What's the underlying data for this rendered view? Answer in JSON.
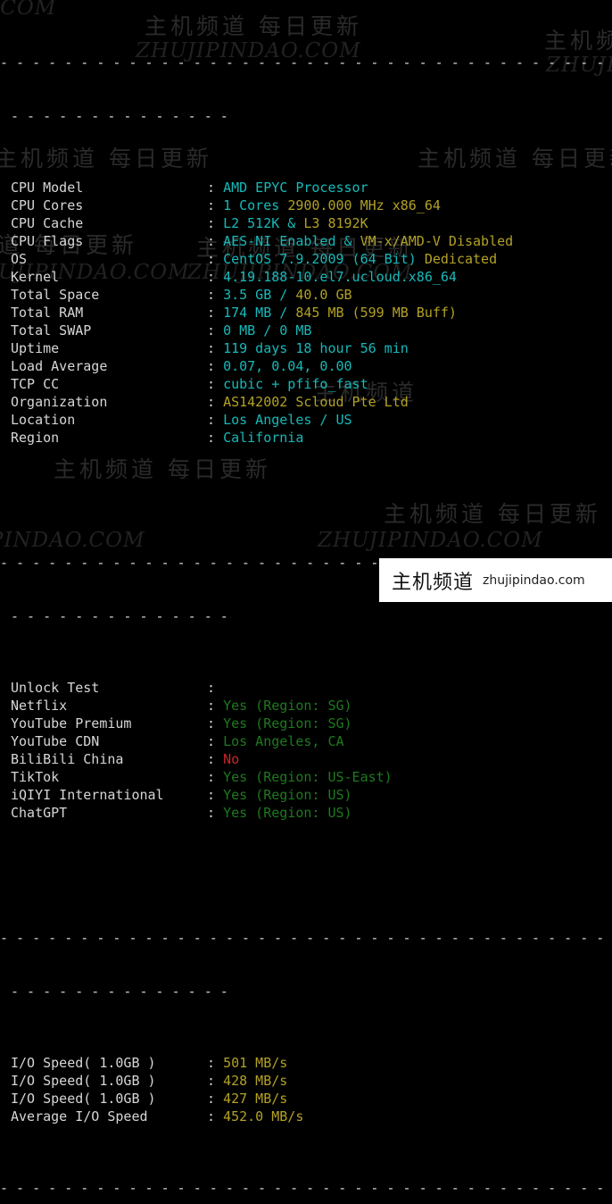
{
  "terminal": {
    "separator_full": "- - - - - - - - - - - - - - - - - - - - - - - - - - - - - - - - - - - - - - - - - - - - - - - - - - - - - - - - - - - - - - - - - - - - - - - - - - - -",
    "separator_short": "- - - - - - - - - - - - - -",
    "colon": ":"
  },
  "system_info": {
    "rows": [
      {
        "label": "CPU Model",
        "value": "AMD EPYC Processor",
        "value2": ""
      },
      {
        "label": "CPU Cores",
        "value": "1 Cores ",
        "value2": "2900.000 MHz x86_64"
      },
      {
        "label": "CPU Cache",
        "value": "L2 512K & ",
        "value2": "L3 8192K"
      },
      {
        "label": "CPU Flags",
        "value": "AES-NI Enabled & ",
        "value2": "VM-x/AMD-V Disabled"
      },
      {
        "label": "OS",
        "value": "CentOS 7.9.2009 (64 Bit) ",
        "value2": "Dedicated"
      },
      {
        "label": "Kernel",
        "value": "4.19.188-10.el7.ucloud.x86_64",
        "value2": ""
      },
      {
        "label": "Total Space",
        "value": "3.5 GB / ",
        "value2": "40.0 GB"
      },
      {
        "label": "Total RAM",
        "value": "174 MB / ",
        "value2": "845 MB (599 MB Buff)"
      },
      {
        "label": "Total SWAP",
        "value": "0 MB / 0 MB",
        "value2": ""
      },
      {
        "label": "Uptime",
        "value": "119 days 18 hour 56 min",
        "value2": ""
      },
      {
        "label": "Load Average",
        "value": "0.07, 0.04, 0.00",
        "value2": ""
      },
      {
        "label": "TCP CC",
        "value": "cubic + pfifo_fast",
        "value2": ""
      },
      {
        "label": "Organization",
        "value": "",
        "value2": "AS142002 Scloud Pte Ltd"
      },
      {
        "label": "Location",
        "value": "Los Angeles / US",
        "value2": ""
      },
      {
        "label": "Region",
        "value": "California",
        "value2": ""
      }
    ]
  },
  "unlock_test": {
    "rows": [
      {
        "label": "Unlock Test",
        "value": ""
      },
      {
        "label": "Netflix",
        "value": "Yes (Region: SG)"
      },
      {
        "label": "YouTube Premium",
        "value": "Yes (Region: SG)"
      },
      {
        "label": "YouTube CDN",
        "value": "Los Angeles, CA"
      },
      {
        "label": "BiliBili China",
        "value": "No"
      },
      {
        "label": "TikTok",
        "value": "Yes (Region: US-East)"
      },
      {
        "label": "iQIYI International",
        "value": "Yes (Region: US)"
      },
      {
        "label": "ChatGPT",
        "value": "Yes (Region: US)"
      }
    ]
  },
  "io_test": {
    "rows": [
      {
        "label": "I/O Speed( 1.0GB )",
        "value": "501 MB/s"
      },
      {
        "label": "I/O Speed( 1.0GB )",
        "value": "428 MB/s"
      },
      {
        "label": "I/O Speed( 1.0GB )",
        "value": "427 MB/s"
      },
      {
        "label": "Average I/O Speed",
        "value": "452.0 MB/s"
      }
    ]
  },
  "watermarks": {
    "cn_text": "主机频道 每日更新",
    "cn_short": "主机频道",
    "en_text": "ZHUJIPINDAO.COM",
    "en_tail": "PINDAO.COM",
    "en_head": ".COM",
    "en_head2": "ZHUJIPI"
  },
  "logo_badge": {
    "cn": "主机频道",
    "en": "zhujipindao.com"
  },
  "colors": {
    "background": "#000000",
    "label": "#d6d6d6",
    "value_cyan": "#17b9b9",
    "value_yellow": "#b3a125",
    "value_green": "#1d7a1d",
    "value_red": "#c62828",
    "watermark": "#2a2a2a",
    "badge_bg": "#ffffff"
  }
}
